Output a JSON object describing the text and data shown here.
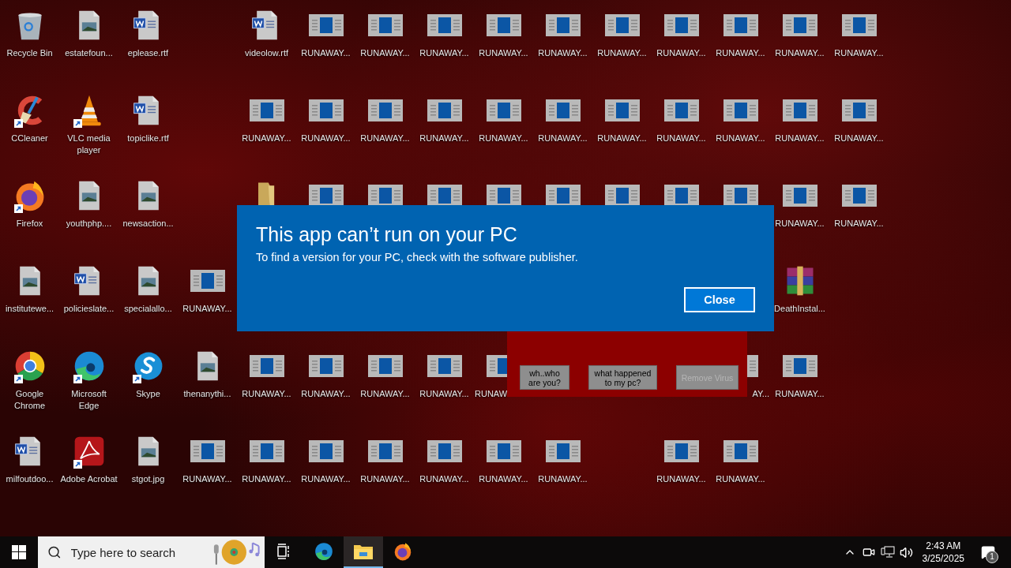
{
  "desktop": {
    "rows": [
      {
        "slots": [
          {
            "kind": "recycle-bin",
            "label": "Recycle Bin",
            "shortcut": false
          },
          {
            "kind": "image-file",
            "label": "estatefoun...",
            "shortcut": false
          },
          {
            "kind": "word-file",
            "label": "eplease.rtf",
            "shortcut": false
          },
          {
            "kind": "empty"
          },
          {
            "kind": "word-file",
            "label": "videolow.rtf",
            "shortcut": false
          },
          {
            "kind": "app",
            "label": "RUNAWAY...",
            "shortcut": false
          },
          {
            "kind": "app",
            "label": "RUNAWAY...",
            "shortcut": false
          },
          {
            "kind": "app",
            "label": "RUNAWAY...",
            "shortcut": false
          },
          {
            "kind": "app",
            "label": "RUNAWAY...",
            "shortcut": false
          },
          {
            "kind": "app",
            "label": "RUNAWAY...",
            "shortcut": false
          },
          {
            "kind": "app",
            "label": "RUNAWAY...",
            "shortcut": false
          },
          {
            "kind": "app",
            "label": "RUNAWAY...",
            "shortcut": false
          },
          {
            "kind": "app",
            "label": "RUNAWAY...",
            "shortcut": false
          },
          {
            "kind": "app",
            "label": "RUNAWAY...",
            "shortcut": false
          },
          {
            "kind": "app",
            "label": "RUNAWAY...",
            "shortcut": false
          }
        ]
      },
      {
        "slots": [
          {
            "kind": "ccleaner",
            "label": "CCleaner",
            "shortcut": true
          },
          {
            "kind": "vlc",
            "label": "VLC media player",
            "shortcut": true
          },
          {
            "kind": "word-file",
            "label": "topiclike.rtf",
            "shortcut": false
          },
          {
            "kind": "empty"
          },
          {
            "kind": "app",
            "label": "RUNAWAY...",
            "shortcut": false
          },
          {
            "kind": "app",
            "label": "RUNAWAY...",
            "shortcut": false
          },
          {
            "kind": "app",
            "label": "RUNAWAY...",
            "shortcut": false
          },
          {
            "kind": "app",
            "label": "RUNAWAY...",
            "shortcut": false
          },
          {
            "kind": "app",
            "label": "RUNAWAY...",
            "shortcut": false
          },
          {
            "kind": "app",
            "label": "RUNAWAY...",
            "shortcut": false
          },
          {
            "kind": "app",
            "label": "RUNAWAY...",
            "shortcut": false
          },
          {
            "kind": "app",
            "label": "RUNAWAY...",
            "shortcut": false
          },
          {
            "kind": "app",
            "label": "RUNAWAY...",
            "shortcut": false
          },
          {
            "kind": "app",
            "label": "RUNAWAY...",
            "shortcut": false
          },
          {
            "kind": "app",
            "label": "RUNAWAY...",
            "shortcut": false
          }
        ]
      },
      {
        "slots": [
          {
            "kind": "firefox",
            "label": "Firefox",
            "shortcut": true
          },
          {
            "kind": "image-file",
            "label": "youthphp....",
            "shortcut": false
          },
          {
            "kind": "image-file",
            "label": "newsaction...",
            "shortcut": false
          },
          {
            "kind": "empty"
          },
          {
            "kind": "folder",
            "shortcut": false
          },
          {
            "kind": "app",
            "shortcut": false
          },
          {
            "kind": "app",
            "shortcut": false
          },
          {
            "kind": "app",
            "shortcut": false
          },
          {
            "kind": "app",
            "shortcut": false
          },
          {
            "kind": "app",
            "shortcut": false
          },
          {
            "kind": "app",
            "shortcut": false
          },
          {
            "kind": "app",
            "shortcut": false
          },
          {
            "kind": "app",
            "shortcut": false
          },
          {
            "kind": "app",
            "label": "RUNAWAY...",
            "shortcut": false
          },
          {
            "kind": "app",
            "label": "RUNAWAY...",
            "shortcut": false
          }
        ]
      },
      {
        "slots": [
          {
            "kind": "image-file",
            "label": "institutewe...",
            "shortcut": false
          },
          {
            "kind": "word-file",
            "label": "policieslate...",
            "shortcut": false
          },
          {
            "kind": "image-file",
            "label": "specialallo...",
            "shortcut": false
          },
          {
            "kind": "app",
            "label": "RUNAWAY...",
            "shortcut": false
          },
          {
            "kind": "empty"
          },
          {
            "kind": "empty"
          },
          {
            "kind": "empty"
          },
          {
            "kind": "empty"
          },
          {
            "kind": "empty"
          },
          {
            "kind": "empty"
          },
          {
            "kind": "empty"
          },
          {
            "kind": "empty"
          },
          {
            "kind": "empty"
          },
          {
            "kind": "winrar",
            "label": "DeathInstal...",
            "shortcut": false
          }
        ]
      },
      {
        "slots": [
          {
            "kind": "chrome",
            "label": "Google Chrome",
            "shortcut": true
          },
          {
            "kind": "edge",
            "label": "Microsoft Edge",
            "shortcut": true
          },
          {
            "kind": "skype",
            "label": "Skype",
            "shortcut": true
          },
          {
            "kind": "image-file",
            "label": "thenanythi...",
            "shortcut": false
          },
          {
            "kind": "app",
            "label": "RUNAWAY...",
            "shortcut": false
          },
          {
            "kind": "app",
            "label": "RUNAWAY...",
            "shortcut": false
          },
          {
            "kind": "app",
            "label": "RUNAWAY...",
            "shortcut": false
          },
          {
            "kind": "app",
            "label": "RUNAWAY...",
            "shortcut": false
          },
          {
            "kind": "app",
            "label": "RUNAW",
            "shortcut": false
          },
          {
            "kind": "empty"
          },
          {
            "kind": "empty"
          },
          {
            "kind": "empty"
          },
          {
            "kind": "app",
            "label": "AY...",
            "shortcut": false
          },
          {
            "kind": "app",
            "label": "RUNAWAY...",
            "shortcut": false
          }
        ]
      },
      {
        "slots": [
          {
            "kind": "word-file",
            "label": "milfoutdoo...",
            "shortcut": false
          },
          {
            "kind": "acrobat",
            "label": "Adobe Acrobat",
            "shortcut": true
          },
          {
            "kind": "image-file",
            "label": "stgot.jpg",
            "shortcut": false
          },
          {
            "kind": "app",
            "label": "RUNAWAY...",
            "shortcut": false
          },
          {
            "kind": "app",
            "label": "RUNAWAY...",
            "shortcut": false
          },
          {
            "kind": "app",
            "label": "RUNAWAY...",
            "shortcut": false
          },
          {
            "kind": "app",
            "label": "RUNAWAY...",
            "shortcut": false
          },
          {
            "kind": "app",
            "label": "RUNAWAY...",
            "shortcut": false
          },
          {
            "kind": "app",
            "label": "RUNAWAY...",
            "shortcut": false
          },
          {
            "kind": "app",
            "label": "RUNAWAY...",
            "shortcut": false
          },
          {
            "kind": "empty"
          },
          {
            "kind": "app",
            "label": "RUNAWAY...",
            "shortcut": false
          },
          {
            "kind": "app",
            "label": "RUNAWAY...",
            "shortcut": false
          }
        ]
      }
    ]
  },
  "virus_window": {
    "buttons": [
      {
        "label": "wh..who are you?",
        "disabled": false
      },
      {
        "label": "what happened to my pc?",
        "disabled": false
      },
      {
        "label": "Remove Virus",
        "disabled": true
      }
    ]
  },
  "dialog": {
    "title": "This app can’t run on your PC",
    "message": "To find a version for your PC, check with the software publisher.",
    "button": "Close"
  },
  "taskbar": {
    "search": {
      "placeholder": "Type here to search"
    },
    "apps": [
      {
        "kind": "task-view",
        "selected": false
      },
      {
        "kind": "edge",
        "selected": false
      },
      {
        "kind": "explorer",
        "selected": true
      },
      {
        "kind": "firefox",
        "selected": false
      }
    ],
    "tray": {
      "time": "2:43 AM",
      "date": "3/25/2025",
      "notifications": "1"
    }
  }
}
